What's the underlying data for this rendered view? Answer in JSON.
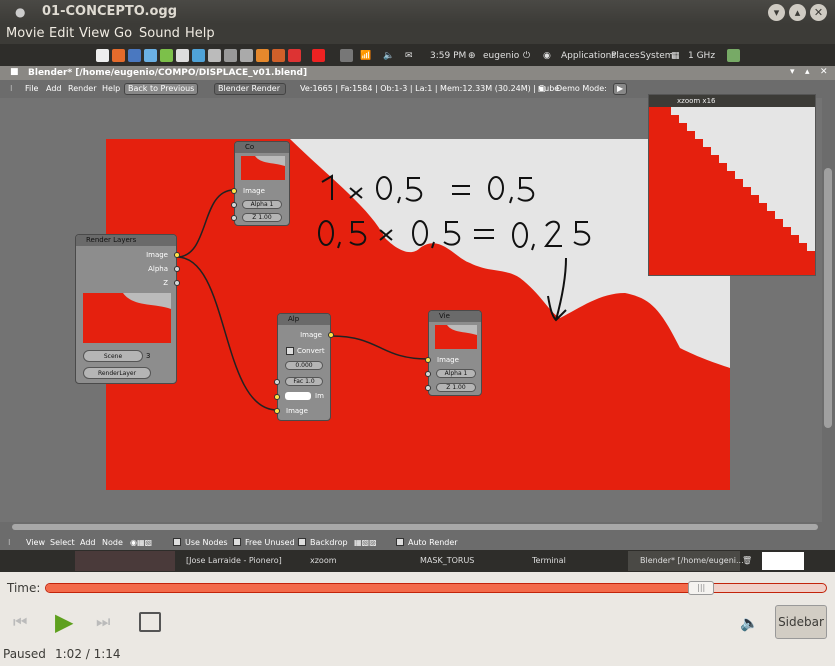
{
  "window": {
    "title": "01-CONCEPTO.ogg"
  },
  "menubar": [
    "Movie",
    "Edit",
    "View",
    "Go",
    "Sound",
    "Help"
  ],
  "panel": {
    "time": "3:59 PM",
    "user": "eugenio",
    "apps": "Applications",
    "places": "Places",
    "system": "System",
    "cpu": "1 GHz"
  },
  "blender": {
    "window_title": "Blender* [/home/eugenio/COMPO/DISPLACE_v01.blend]",
    "header": {
      "file": "File",
      "add": "Add",
      "render": "Render",
      "help": "Help",
      "back": "Back to Previous",
      "engine": "Blender Render",
      "stats": "Ve:1665 | Fa:1584 | Ob:1-3 | La:1 | Mem:12.33M (30.24M) | Cube",
      "demo": "Demo Mode:"
    },
    "annotation": {
      "line1": "1 x 0,5 = 0,5",
      "line2": "0,5 x 0,5 = 0,25"
    },
    "nodes": {
      "render_layers": {
        "title": "Render Layers",
        "outputs": [
          "Image",
          "Alpha",
          "Z"
        ],
        "scene": "Scene",
        "scene_num": "3",
        "layer": "RenderLayer"
      },
      "composite": {
        "title": "Co",
        "inputs": [
          "Image"
        ],
        "alpha": "Alpha 1",
        "z": "Z 1.00"
      },
      "alpha_over": {
        "title": "Alp",
        "output": "Image",
        "convert": "Convert",
        "value": "0.000",
        "fac": "Fac 1.0",
        "im": "Im",
        "image": "Image"
      },
      "viewer": {
        "title": "Vie",
        "inputs": [
          "Image"
        ],
        "alpha": "Alpha 1",
        "z": "Z 1.00"
      }
    },
    "footer": {
      "view": "View",
      "select": "Select",
      "add": "Add",
      "node": "Node",
      "use_nodes": "Use Nodes",
      "free_unused": "Free Unused",
      "backdrop": "Backdrop",
      "auto_render": "Auto Render"
    }
  },
  "xzoom": {
    "title": "xzoom x16"
  },
  "taskbar": [
    "[Jose Larraide - Pionero]",
    "xzoom",
    "MASK_TORUS",
    "Terminal",
    "Blender* [/home/eugeni..."
  ],
  "player": {
    "time_label": "Time:",
    "status": "Paused",
    "position": "1:02 / 1:14",
    "sidebar": "Sidebar",
    "progress": 0.84
  },
  "colors": {
    "accent_red": "#e5200e",
    "ubuntu_dark": "#3c3b37"
  }
}
